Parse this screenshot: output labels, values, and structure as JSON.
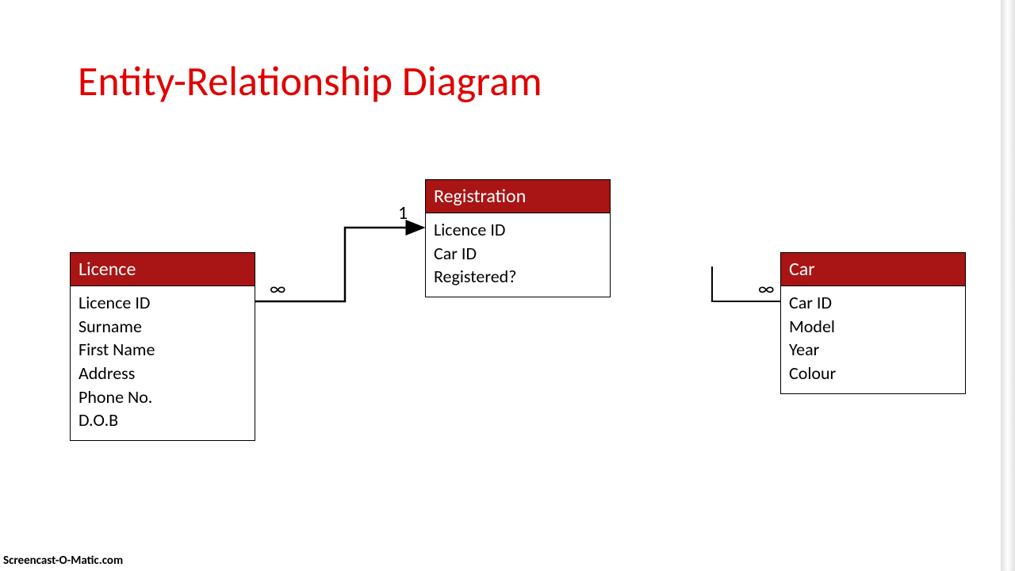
{
  "title": "Entity-Relationship Diagram",
  "entities": {
    "licence": {
      "name": "Licence",
      "fields": [
        "Licence ID",
        "Surname",
        "First Name",
        "Address",
        "Phone No.",
        "D.O.B"
      ]
    },
    "registration": {
      "name": "Registration",
      "fields": [
        "Licence ID",
        "Car ID",
        "Registered?"
      ]
    },
    "car": {
      "name": "Car",
      "fields": [
        "Car ID",
        "Model",
        "Year",
        "Colour"
      ]
    }
  },
  "cardinality": {
    "licence_side": "∞",
    "registration_side": "1",
    "car_side": "∞"
  },
  "footer": "Screencast-O-Matic.com"
}
